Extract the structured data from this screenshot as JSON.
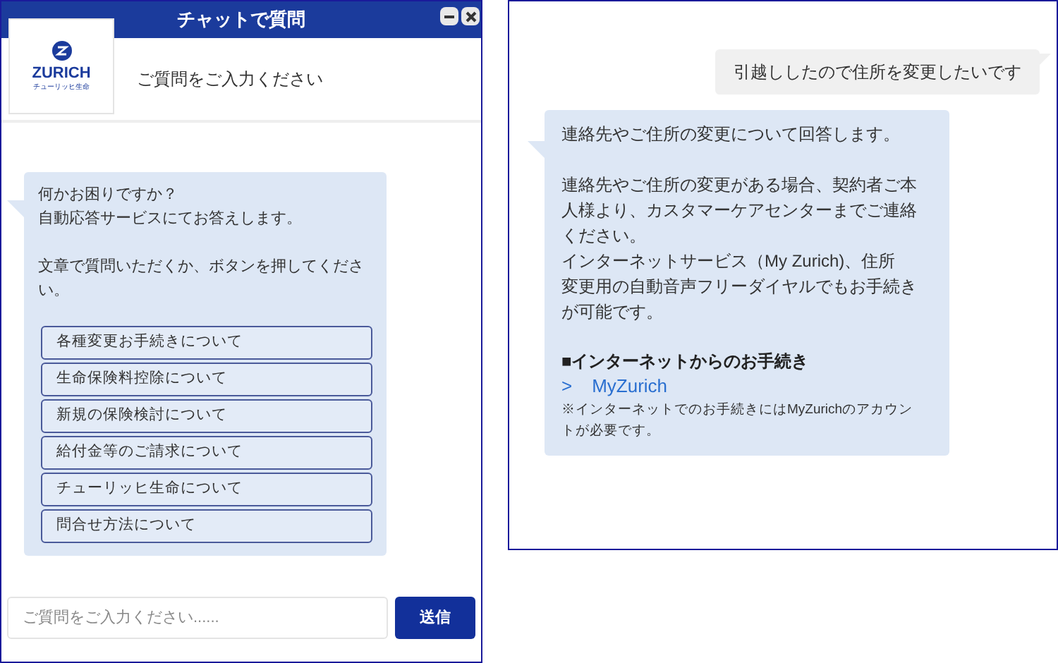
{
  "chat_window": {
    "title": "チャットで質問",
    "logo": {
      "name": "ZURICH",
      "subtitle": "チューリッヒ生命"
    },
    "header_prompt": "ご質問をご入力ください",
    "bot_message": {
      "paragraphs": [
        [
          "何かお困りですか？",
          "自動応答サービスにてお答えします。"
        ],
        [
          "文章で質問いただくか、ボタンを押してくださ",
          "い。"
        ]
      ],
      "options": [
        {
          "label": "各種変更お手続きについて"
        },
        {
          "label": "生命保険料控除について"
        },
        {
          "label": "新規の保険検討について"
        },
        {
          "label": "給付金等のご請求について"
        },
        {
          "label": "チューリッヒ生命について"
        },
        {
          "label": "問合せ方法について"
        }
      ]
    },
    "input": {
      "placeholder": "ご質問をご入力ください......"
    },
    "send_button": "送信"
  },
  "conversation": {
    "user_message": "引越ししたので住所を変更したいです",
    "bot_reply": {
      "paragraphs": [
        [
          "連絡先やご住所の変更について回答します。"
        ],
        [
          "連絡先やご住所の変更がある場合、契約者ご本",
          "人様より、カスタマーケアセンターまでご連絡",
          "ください。",
          "インターネットサービス（My Zurich)、住所",
          "変更用の自動音声フリーダイヤルでもお手続き",
          "が可能です。"
        ]
      ],
      "heading": "■インターネットからのお手続き",
      "link_arrow": ">",
      "link": "MyZurich",
      "note": [
        "※インターネットでのお手続きにはMyZurichのアカウン",
        "トが必要です。"
      ]
    }
  }
}
